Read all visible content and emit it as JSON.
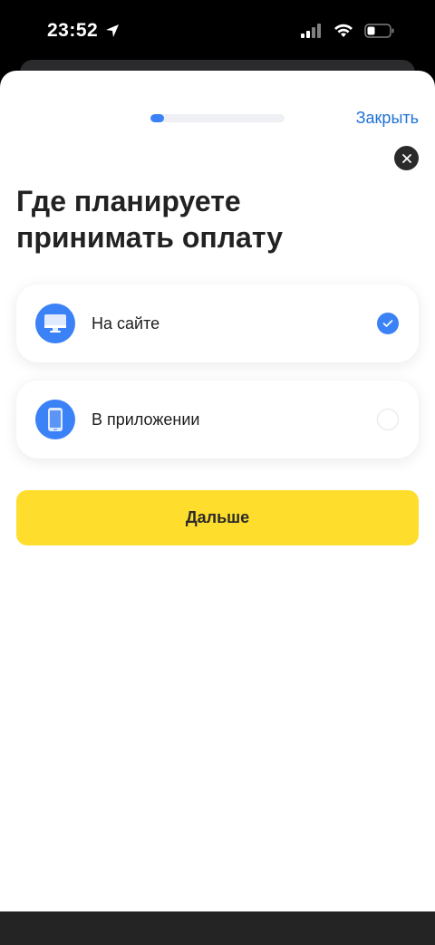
{
  "status_bar": {
    "time": "23:52"
  },
  "progress": {
    "fraction": 0.1
  },
  "header": {
    "close_label": "Закрыть"
  },
  "question": {
    "title": "Где планируете принимать оплату"
  },
  "options": [
    {
      "label": "На сайте",
      "icon": "monitor-icon",
      "selected": true
    },
    {
      "label": "В приложении",
      "icon": "phone-icon",
      "selected": false
    }
  ],
  "actions": {
    "next_label": "Дальше"
  },
  "colors": {
    "accent": "#3b82f6",
    "primary_button": "#fedd2c",
    "link": "#1f72d8"
  }
}
